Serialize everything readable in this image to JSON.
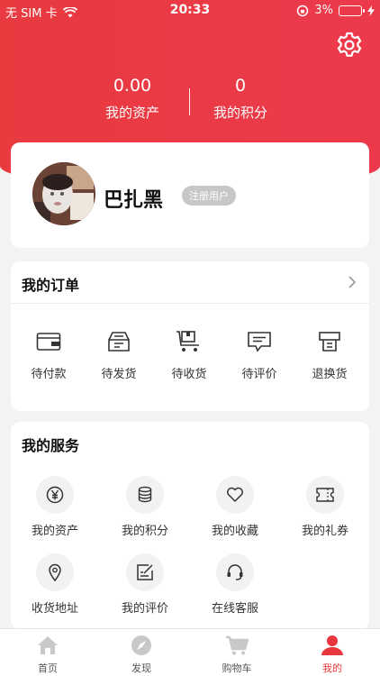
{
  "status_bar": {
    "carrier": "无 SIM 卡",
    "time": "20:33",
    "battery": "3%"
  },
  "header": {
    "stats": [
      {
        "value": "0.00",
        "label": "我的资产"
      },
      {
        "value": "0",
        "label": "我的积分"
      }
    ]
  },
  "profile": {
    "username": "巴扎黑",
    "badge": "注册用户"
  },
  "orders": {
    "title": "我的订单",
    "items": [
      {
        "label": "待付款",
        "icon": "wallet-icon"
      },
      {
        "label": "待发货",
        "icon": "package-icon"
      },
      {
        "label": "待收货",
        "icon": "cart-box-icon"
      },
      {
        "label": "待评价",
        "icon": "comment-icon"
      },
      {
        "label": "退换货",
        "icon": "return-icon"
      }
    ]
  },
  "services": {
    "title": "我的服务",
    "items": [
      {
        "label": "我的资产",
        "icon": "yen-icon"
      },
      {
        "label": "我的积分",
        "icon": "coins-icon"
      },
      {
        "label": "我的收藏",
        "icon": "heart-icon"
      },
      {
        "label": "我的礼券",
        "icon": "ticket-icon"
      },
      {
        "label": "收货地址",
        "icon": "location-icon"
      },
      {
        "label": "我的评价",
        "icon": "edit-icon"
      },
      {
        "label": "在线客服",
        "icon": "headset-icon"
      }
    ]
  },
  "tabbar": {
    "active_color": "#e8383d",
    "items": [
      {
        "label": "首页",
        "icon": "home-icon"
      },
      {
        "label": "发现",
        "icon": "compass-icon"
      },
      {
        "label": "购物车",
        "icon": "cart-icon"
      },
      {
        "label": "我的",
        "icon": "user-icon"
      }
    ]
  }
}
